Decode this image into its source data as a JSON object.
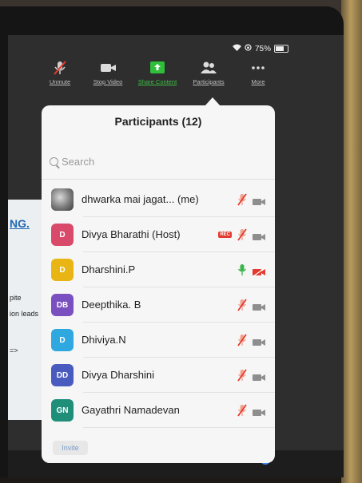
{
  "status": {
    "battery_pct": "75%",
    "battery_level": 0.75
  },
  "toolbar": {
    "unmute": "Unmute",
    "stop_video": "Stop Video",
    "share_content": "Share Content",
    "participants": "Participants",
    "more": "More"
  },
  "panel": {
    "title": "Participants (12)",
    "search_placeholder": "Search",
    "invite_label": "Invite"
  },
  "participants": [
    {
      "name": "dhwarka mai jagat...  (me)",
      "initials": "",
      "avatar_color": "",
      "mic": "muted",
      "video": "on",
      "rec": false
    },
    {
      "name": "Divya Bharathi (Host)",
      "initials": "D",
      "avatar_color": "#d94a6a",
      "mic": "muted",
      "video": "on",
      "rec": true,
      "rec_label": "REC"
    },
    {
      "name": "Dharshini.P",
      "initials": "D",
      "avatar_color": "#e8b514",
      "mic": "active",
      "video": "off",
      "rec": false
    },
    {
      "name": "Deepthika. B",
      "initials": "DB",
      "avatar_color": "#7a4fc0",
      "mic": "muted",
      "video": "on",
      "rec": false
    },
    {
      "name": "Dhiviya.N",
      "initials": "D",
      "avatar_color": "#2fa8e0",
      "mic": "muted",
      "video": "on",
      "rec": false
    },
    {
      "name": "Divya Dharshini",
      "initials": "DD",
      "avatar_color": "#4a5bbf",
      "mic": "muted",
      "video": "on",
      "rec": false
    },
    {
      "name": "Gayathri Namadevan",
      "initials": "GN",
      "avatar_color": "#1f8f7a",
      "mic": "muted",
      "video": "on",
      "rec": false
    }
  ],
  "background_doc": {
    "heading": "NG.",
    "lines": [
      "pite",
      "ion leads",
      "=>"
    ]
  },
  "colors": {
    "accent_green": "#3fbf44",
    "mute_red": "#e43a2f",
    "panel_bg": "#f6f6f6"
  }
}
